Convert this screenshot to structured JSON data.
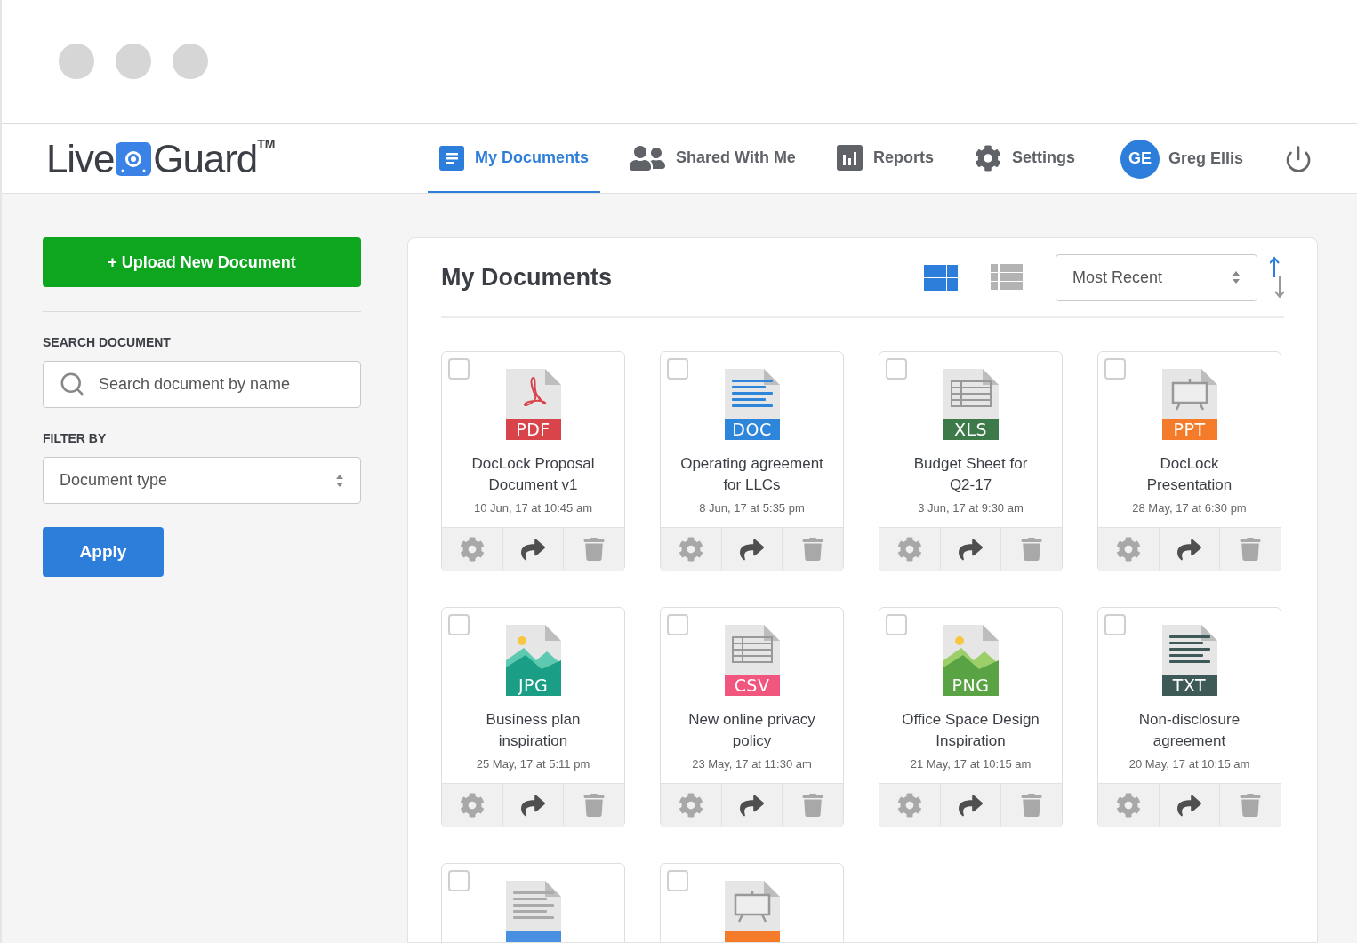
{
  "logo": {
    "left": "Live",
    "right": "Guard",
    "mark": "TM"
  },
  "nav": [
    {
      "kind": "documents",
      "label": "My Documents",
      "selected": true
    },
    {
      "kind": "shared",
      "label": "Shared With Me",
      "selected": false
    },
    {
      "kind": "reports",
      "label": "Reports",
      "selected": false
    },
    {
      "kind": "settings",
      "label": "Settings",
      "selected": false
    }
  ],
  "user": {
    "initials": "GE",
    "name": "Greg Ellis"
  },
  "sidebar": {
    "upload_button": "+ Upload New Document",
    "search_label": "SEARCH DOCUMENT",
    "search_placeholder": "Search document by name",
    "filter_label": "FILTER BY",
    "filter_value": "Document type",
    "apply_button": "Apply"
  },
  "main": {
    "title": "My Documents",
    "views": [
      {
        "kind": "grid",
        "selected": true
      },
      {
        "kind": "list",
        "selected": false
      }
    ],
    "sort": "Most Recent",
    "sort_ascending": true
  },
  "cards": [
    {
      "kind": "pdf",
      "label": "PDF",
      "title_lines": [
        "DocLock Proposal",
        "Document v1"
      ],
      "date": "10 Jun, 17 at 10:45 am",
      "checked": false
    },
    {
      "kind": "doc",
      "label": "DOC",
      "title_lines": [
        "Operating agreement",
        "for LLCs"
      ],
      "date": "8 Jun, 17 at 5:35 pm",
      "checked": false
    },
    {
      "kind": "xls",
      "label": "XLS",
      "title_lines": [
        "Budget Sheet for",
        "Q2-17"
      ],
      "date": "3 Jun, 17 at 9:30 am",
      "checked": false
    },
    {
      "kind": "ppt",
      "label": "PPT",
      "title_lines": [
        "DocLock",
        "Presentation"
      ],
      "date": "28 May, 17 at 6:30 pm",
      "checked": false
    },
    {
      "kind": "jpg",
      "label": "JPG",
      "title_lines": [
        "Business plan",
        "inspiration"
      ],
      "date": "25 May, 17 at 5:11 pm",
      "checked": false
    },
    {
      "kind": "csv",
      "label": "CSV",
      "title_lines": [
        "New online privacy",
        "policy"
      ],
      "date": "23 May, 17 at 11:30 am",
      "checked": false
    },
    {
      "kind": "png",
      "label": "PNG",
      "title_lines": [
        "Office Space Design",
        "Inspiration"
      ],
      "date": "21 May, 17 at 10:15 am",
      "checked": false
    },
    {
      "kind": "txt",
      "label": "TXT",
      "title_lines": [
        "Non-disclosure",
        "agreement"
      ],
      "date": "20 May, 17 at 10:15 am",
      "checked": false
    },
    {
      "kind": "rtf",
      "checked": false
    },
    {
      "kind": "ppt",
      "checked": false
    }
  ]
}
